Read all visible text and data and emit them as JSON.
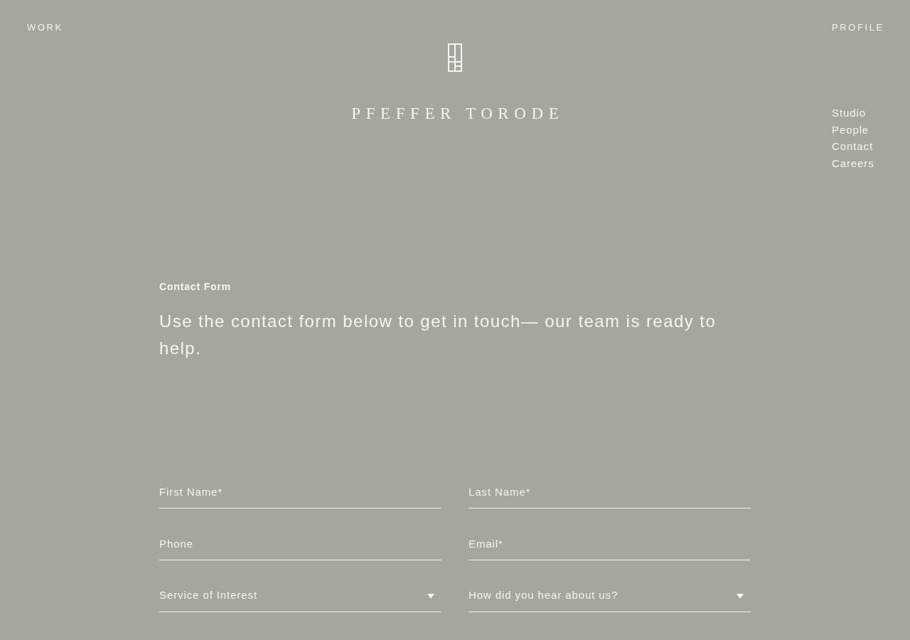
{
  "header": {
    "left_link": "WORK",
    "right_link": "PROFILE",
    "brand": "PFEFFER TORODE"
  },
  "nav": [
    "Studio",
    "People",
    "Contact",
    "Careers"
  ],
  "intro": {
    "heading": "Contact Form",
    "text": "Use the contact form below to get in touch— our team is ready to help."
  },
  "form": {
    "fields": [
      {
        "kind": "text",
        "placeholder": "First Name*"
      },
      {
        "kind": "text",
        "placeholder": "Last Name*"
      },
      {
        "kind": "text",
        "placeholder": "Phone"
      },
      {
        "kind": "text",
        "placeholder": "Email*"
      },
      {
        "kind": "select",
        "placeholder": "Service of Interest"
      },
      {
        "kind": "select",
        "placeholder": "How did you hear about us?"
      }
    ]
  }
}
